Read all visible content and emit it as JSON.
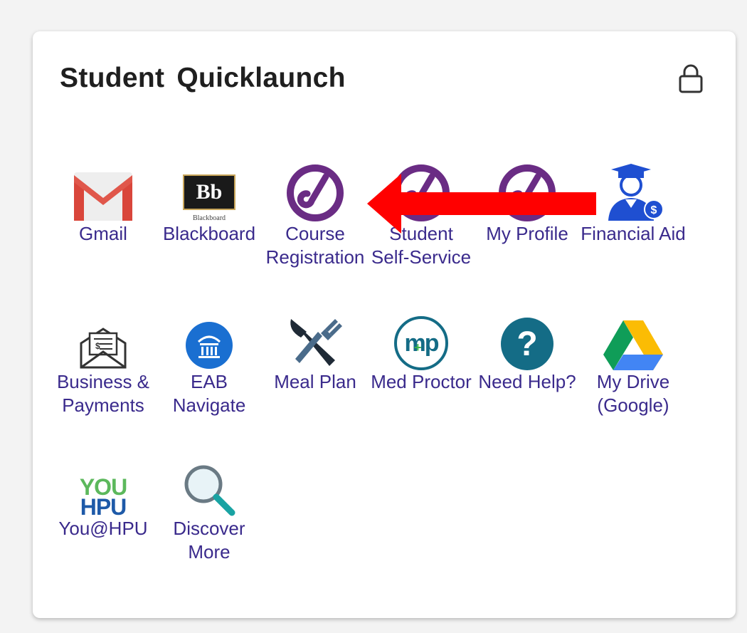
{
  "widget": {
    "title": "Student Quicklaunch",
    "lock_icon": "lock-icon"
  },
  "tiles": [
    {
      "label": "Gmail",
      "icon": "gmail-icon"
    },
    {
      "label": "Blackboard",
      "icon": "blackboard-icon",
      "icon_text": "Bb",
      "icon_subtext": "Blackboard"
    },
    {
      "label": "Course Registration",
      "icon": "ellucian-icon"
    },
    {
      "label": "Student Self-Service",
      "icon": "ellucian-icon"
    },
    {
      "label": "My Profile",
      "icon": "ellucian-icon"
    },
    {
      "label": "Financial Aid",
      "icon": "graduate-money-icon"
    },
    {
      "label": "Business & Payments",
      "icon": "envelope-bill-icon"
    },
    {
      "label": "EAB Navigate",
      "icon": "eab-navigate-icon"
    },
    {
      "label": "Meal Plan",
      "icon": "knife-fork-icon"
    },
    {
      "label": "Med Proctor",
      "icon": "med-proctor-icon",
      "icon_text": "mp"
    },
    {
      "label": "Need Help?",
      "icon": "help-question-icon",
      "icon_text": "?"
    },
    {
      "label": "My Drive (Google)",
      "icon": "google-drive-icon"
    },
    {
      "label": "You@HPU",
      "icon": "you-hpu-icon",
      "icon_text": "YOU",
      "icon_subtext": "HPU"
    },
    {
      "label": "Discover More",
      "icon": "magnifier-icon"
    }
  ],
  "annotation": {
    "icon": "red-arrow-icon",
    "color": "#ff0000"
  },
  "colors": {
    "label": "#3a2a8c",
    "ellucian_purple": "#6a2c84",
    "eab_blue": "#1a6fd1",
    "help_teal": "#146c86",
    "financial_blue": "#1f4fd1"
  }
}
